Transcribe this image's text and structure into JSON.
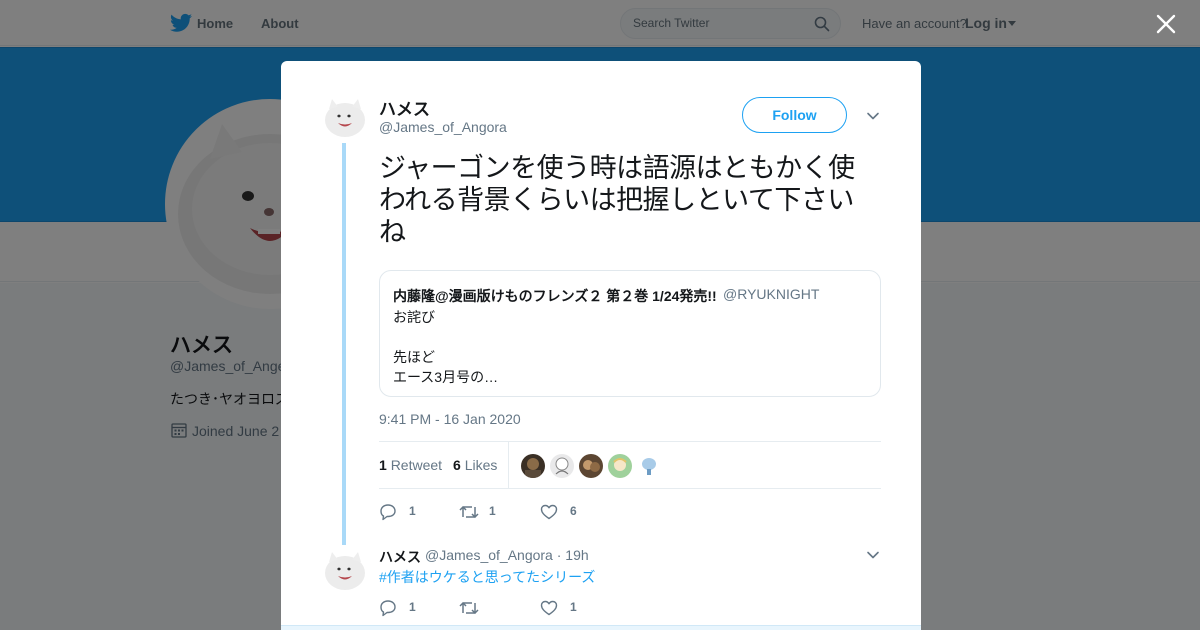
{
  "nav": {
    "home": "Home",
    "about": "About",
    "search_placeholder": "Search Twitter",
    "account_prompt": "Have an account?",
    "login": "Log in"
  },
  "background_profile": {
    "name": "ハメス",
    "handle": "@James_of_Ange",
    "bio": "たつき･ヤオヨロズ",
    "joined": "Joined June 2"
  },
  "tweet": {
    "author_name": "ハメス",
    "author_handle": "@James_of_Angora",
    "follow_label": "Follow",
    "text": "ジャーゴンを使う時は語源はともかく使われる背景くらいは把握しといて下さいね",
    "timestamp": "9:41 PM - 16 Jan 2020",
    "quote": {
      "name": "内藤隆@漫画版けものフレンズ２ 第２巻 1/24発売!!",
      "handle": "@RYUKNIGHT",
      "lines": [
        "お詫び",
        "",
        "先ほど",
        "エース3月号の…"
      ]
    },
    "stats": {
      "retweets": "1",
      "retweet_label": "Retweet",
      "likes": "6",
      "likes_label": "Likes"
    },
    "actions": {
      "replies": "1",
      "retweets": "1",
      "likes": "6"
    }
  },
  "reply": {
    "name": "ハメス",
    "meta": "@James_of_Angora · 19h",
    "text": "#作者はウケると思ってたシリーズ",
    "actions": {
      "replies": "1",
      "retweets": "",
      "likes": "1"
    }
  },
  "colors": {
    "accent": "#1da1f2",
    "cover": "#1da1f2",
    "thread_line": "#a9d9f8",
    "muted_text": "#657786"
  },
  "icons": [
    "twitter-bird-icon",
    "search-icon",
    "close-icon",
    "chevron-down-icon",
    "reply-icon",
    "retweet-icon",
    "heart-icon",
    "calendar-icon"
  ]
}
